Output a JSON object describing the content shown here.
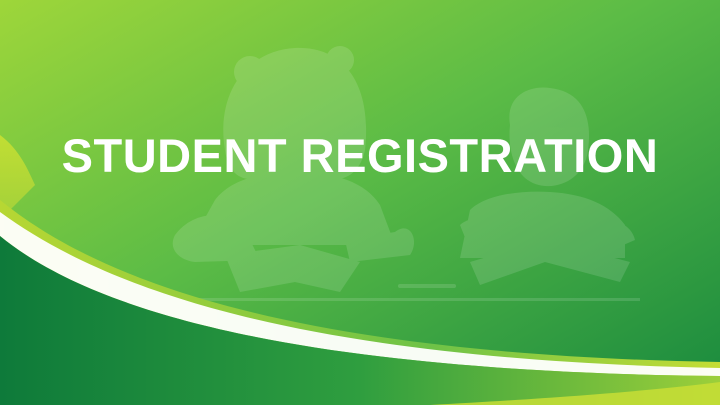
{
  "banner": {
    "title": "STUDENT REGISTRATION",
    "illustration": "children-studying-illustration"
  },
  "colors": {
    "background_light": "#8fd43a",
    "background_mid": "#4bb648",
    "background_dark": "#1a8a3e",
    "wave_lime": "#c6dc32",
    "wave_white": "#ffffff",
    "wave_dark_green": "#0f7a3a",
    "title_text": "#ffffff"
  }
}
